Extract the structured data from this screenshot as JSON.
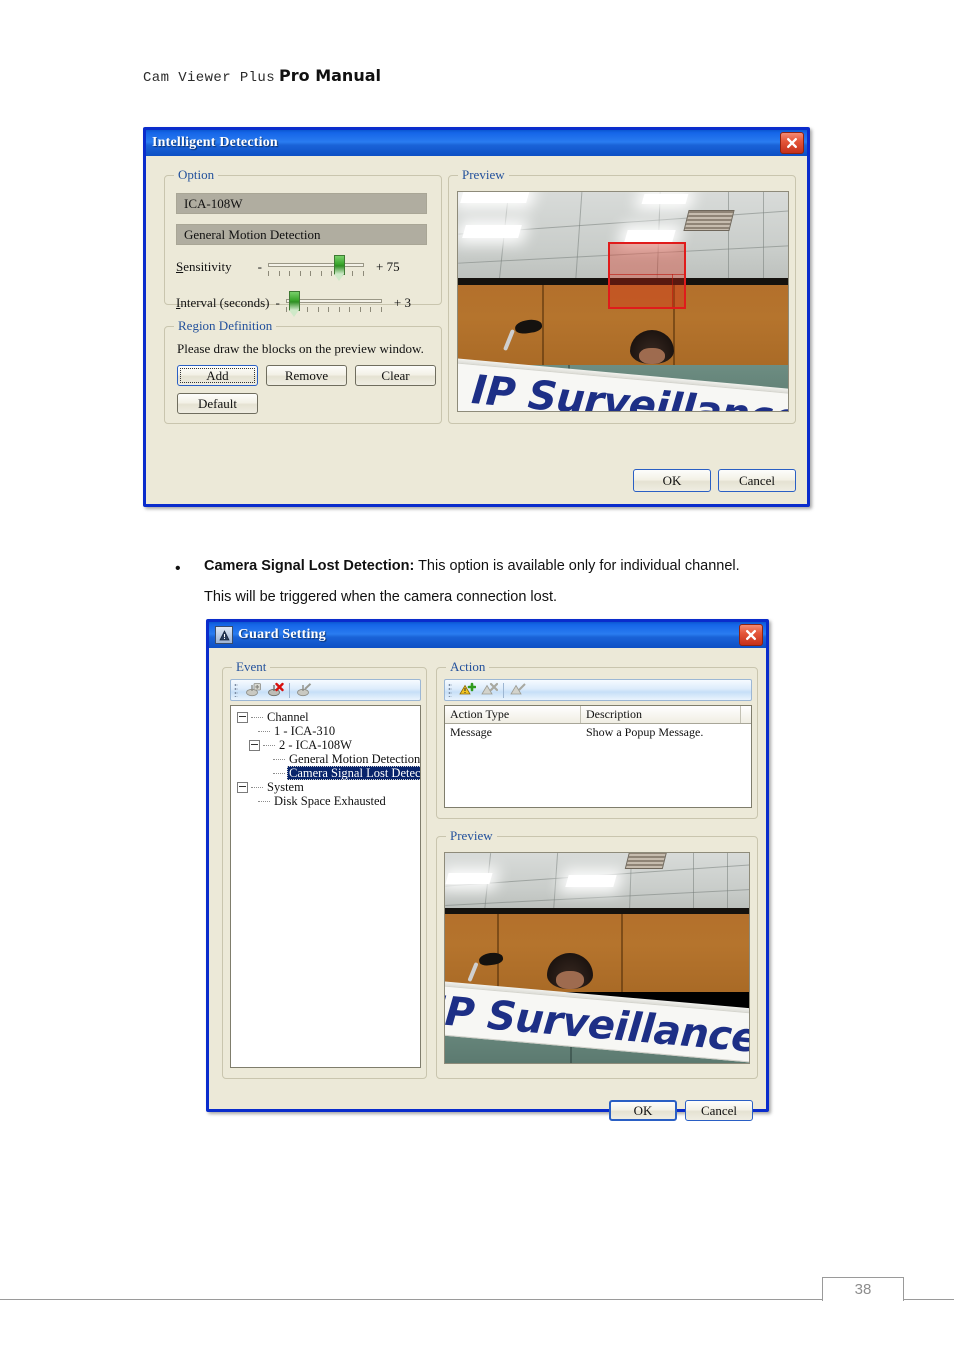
{
  "page": {
    "header_mono": "Cam Viewer Plus",
    "header_bold": "Pro Manual",
    "page_number": "38"
  },
  "bullet": {
    "marker": "•",
    "title": "Camera Signal Lost Detection:",
    "line1": " This option is available only for individual channel.",
    "line2": "This will be triggered when the camera connection lost."
  },
  "dialog1": {
    "title": "Intelligent Detection",
    "close_icon": "close-icon",
    "option_group": "Option",
    "camera_field": "ICA-108W",
    "detection_field": "General Motion Detection",
    "sensitivity": {
      "label_underline": "S",
      "label_rest": "ensitivity",
      "minus": "-",
      "plus": "+",
      "value": "75"
    },
    "interval": {
      "label_underline": "I",
      "label_rest": "nterval (seconds)",
      "minus": "-",
      "plus": "+",
      "value": "3"
    },
    "region_group": "Region Definition",
    "region_hint": "Please draw the blocks on the preview window.",
    "buttons": {
      "add": "Add",
      "remove": "Remove",
      "clear": "Clear",
      "default": "Default",
      "ok": "OK",
      "cancel": "Cancel"
    },
    "preview_group": "Preview",
    "preview_banner_text": "IP Surveillance"
  },
  "dialog2": {
    "title": "Guard Setting",
    "title_icon": "guard-icon",
    "close_icon": "close-icon",
    "event_group": "Event",
    "event_toolbar": [
      {
        "name": "add-event-icon",
        "enabled": false
      },
      {
        "name": "delete-event-icon",
        "enabled": true
      },
      {
        "name": "edit-event-icon",
        "enabled": false
      }
    ],
    "tree": [
      {
        "label": "Channel",
        "level": 0,
        "expander": true,
        "selected": false
      },
      {
        "label": "1 - ICA-310",
        "level": 1,
        "expander": false,
        "selected": false
      },
      {
        "label": "2 - ICA-108W",
        "level": 1,
        "expander": true,
        "selected": false
      },
      {
        "label": "General Motion Detection",
        "level": 2,
        "expander": false,
        "selected": false
      },
      {
        "label": "Camera Signal Lost Detection",
        "level": 2,
        "expander": false,
        "selected": true
      },
      {
        "label": "System",
        "level": 0,
        "expander": true,
        "selected": false
      },
      {
        "label": "Disk Space Exhausted",
        "level": 1,
        "expander": false,
        "selected": false
      }
    ],
    "action_group": "Action",
    "action_toolbar": [
      {
        "name": "add-action-icon",
        "enabled": true
      },
      {
        "name": "delete-action-icon",
        "enabled": false
      },
      {
        "name": "edit-action-icon",
        "enabled": false
      }
    ],
    "action_columns": [
      "Action Type",
      "Description"
    ],
    "action_rows": [
      {
        "type": "Message",
        "description": "Show a Popup Message."
      }
    ],
    "preview_group": "Preview",
    "preview_banner_text": "IP Surveillance",
    "buttons": {
      "ok": "OK",
      "cancel": "Cancel"
    }
  },
  "colors": {
    "title_blue": "#1565e8",
    "dialog_face": "#ece9d8",
    "group_label": "#23519c",
    "selection": "#08246b",
    "region_red": "#e01b1b",
    "slider_green": "#3aa62c"
  }
}
